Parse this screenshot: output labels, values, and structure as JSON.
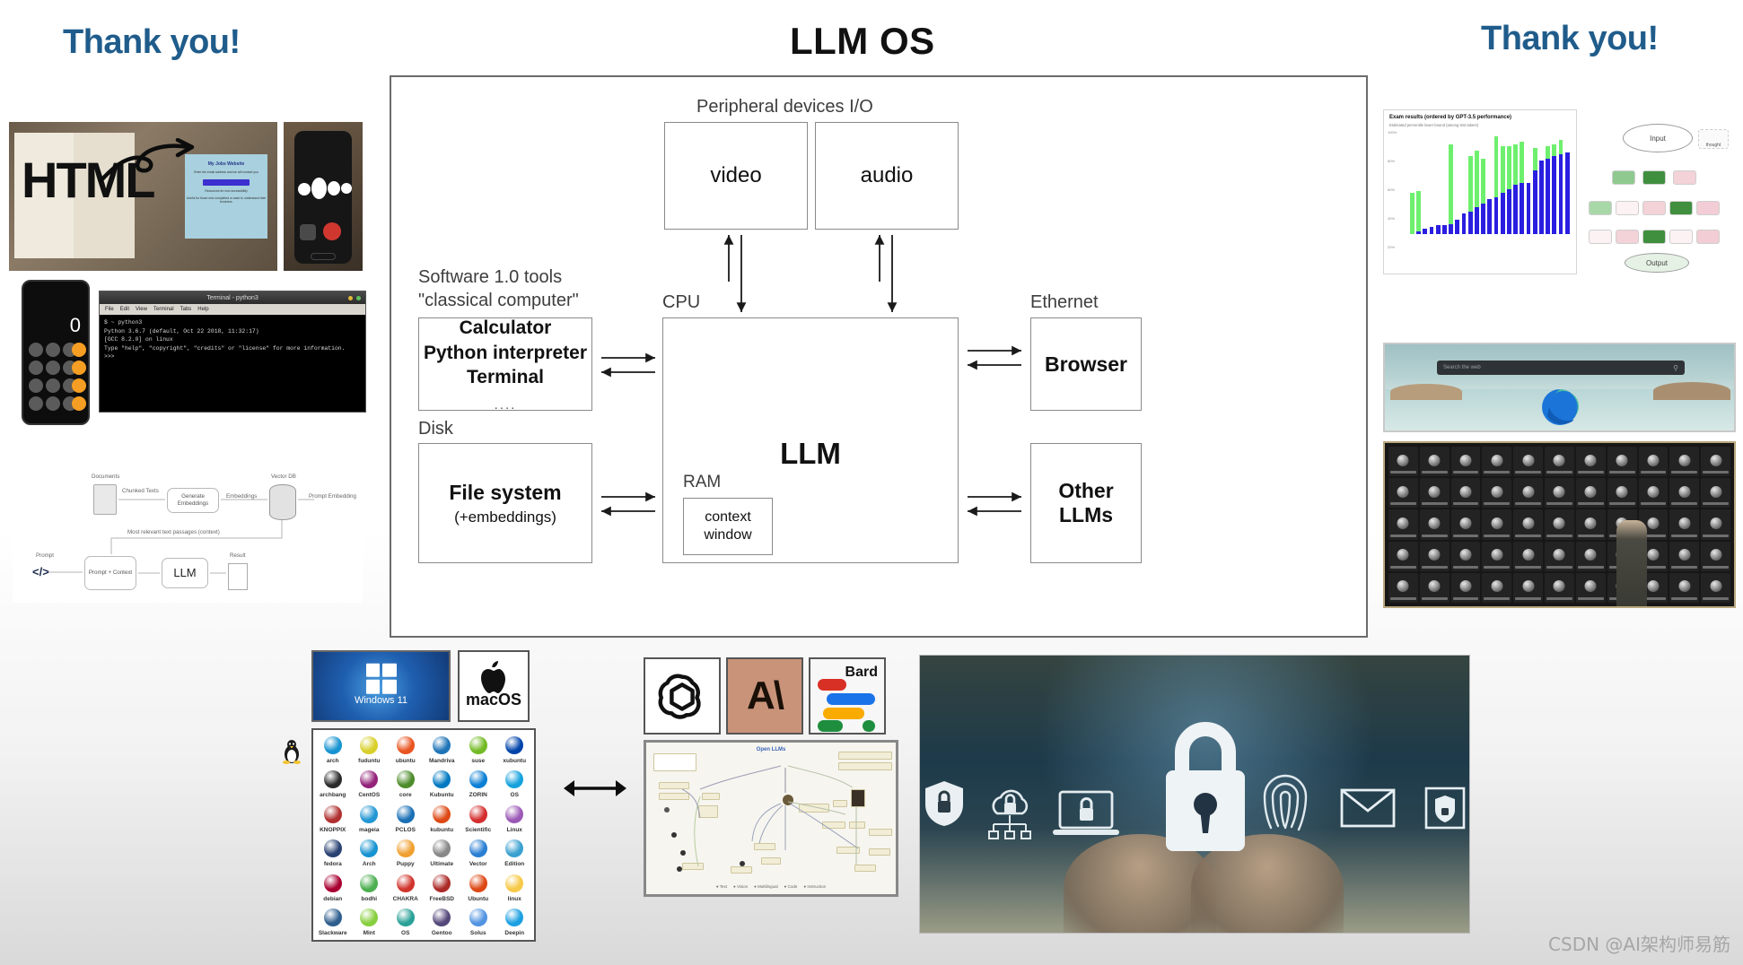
{
  "slide": {
    "title": "LLM OS",
    "thanks_left": "Thank you!",
    "thanks_right": "Thank you!",
    "watermark": "CSDN @AI架构师易筋",
    "accent_blue": "#1f5c8b",
    "frame_border": "#6b6b6b"
  },
  "diagram": {
    "peripheral_label": "Peripheral devices I/O",
    "video_label": "video",
    "audio_label": "audio",
    "software_label_line1": "Software 1.0 tools",
    "software_label_line2": "\"classical computer\"",
    "tools": {
      "line1": "Calculator",
      "line2": "Python interpreter",
      "line3": "Terminal",
      "line4": "...."
    },
    "disk_label": "Disk",
    "filesystem": {
      "line1": "File system",
      "line2": "(+embeddings)"
    },
    "cpu_label": "CPU",
    "llm_label": "LLM",
    "ram_label": "RAM",
    "context_window": {
      "line1": "context",
      "line2": "window"
    },
    "ethernet_label": "Ethernet",
    "browser_label": "Browser",
    "other_llms_label": "Other LLMs"
  },
  "left_media": {
    "html_note": {
      "name": "html-sketch-to-website-photo",
      "word": "HTML",
      "site_title": "My Jobs Website",
      "site_sub": "Enter the email address and we will contact you",
      "site_link": "Resources for new accessibility",
      "site_foot": "Useful for those who completed or want to understand their business"
    },
    "phone_call": {
      "name": "phone-voice-call-photo"
    },
    "calculator_phone": {
      "name": "phone-calculator-photo",
      "readout": "0"
    },
    "terminal": {
      "name": "linux-terminal-screenshot",
      "titlebar": "Terminal - python3",
      "menu": [
        "File",
        "Edit",
        "View",
        "Terminal",
        "Tabs",
        "Help"
      ],
      "body": "$ ~ python3\nPython 3.6.7 (default, Oct 22 2018, 11:32:17)\n[GCC 8.2.0] on linux\nType \"help\", \"copyright\", \"credits\" or \"license\" for more information.\n>>> "
    },
    "rag_diagram": {
      "name": "rag-pipeline-diagram",
      "labels": {
        "documents": "Documents",
        "chunked_texts": "Chunked Texts",
        "generate_embeddings": "Generate Embeddings",
        "embeddings": "Embeddings",
        "vector_db": "Vector DB",
        "prompt_embedding": "Prompt Embedding",
        "context_passages": "Most relevant text passages (context)",
        "prompt": "Prompt",
        "code_glyph": "</>",
        "prompt_context": "Prompt + Context",
        "llm": "LLM",
        "result": "Result"
      }
    }
  },
  "right_media": {
    "exam_chart": {
      "name": "gpt4-exam-results-chart",
      "title": "Exam results (ordered by GPT-3.5 performance)",
      "subtitle": "Estimated percentile lower bound (among test takers)"
    },
    "tree_of_thought": {
      "name": "tree-of-thought-diagram",
      "input": "Input",
      "output": "Output",
      "legend": "thought"
    },
    "edge_browser": {
      "name": "microsoft-edge-new-tab-screenshot",
      "search_placeholder": "Search the web"
    },
    "gpt_grid": {
      "name": "gpt-store-grid-slide"
    }
  },
  "bottom": {
    "windows": {
      "name": "windows-11-tile",
      "label": "Windows 11"
    },
    "macos": {
      "name": "macos-tile",
      "label": "macOS"
    },
    "linux": {
      "name": "linux-distros-collage",
      "distros": [
        {
          "label": "arch",
          "color": "#1793d1"
        },
        {
          "label": "fuduntu",
          "color": "#d8cf2a"
        },
        {
          "label": "ubuntu",
          "color": "#e95420"
        },
        {
          "label": "Mandriva",
          "color": "#1f74b8"
        },
        {
          "label": "suse",
          "color": "#73ba25"
        },
        {
          "label": "xubuntu",
          "color": "#0044aa"
        },
        {
          "label": "archbang",
          "color": "#2b2b2b"
        },
        {
          "label": "CentOS",
          "color": "#932279"
        },
        {
          "label": "core",
          "color": "#4c8c2b"
        },
        {
          "label": "Kubuntu",
          "color": "#0079c1"
        },
        {
          "label": "ZORIN",
          "color": "#0b7fd4"
        },
        {
          "label": "OS",
          "color": "#15a2dd"
        },
        {
          "label": "KNOPPIX",
          "color": "#b03030"
        },
        {
          "label": "mageia",
          "color": "#2397d4"
        },
        {
          "label": "PCLOS",
          "color": "#1a6fb5"
        },
        {
          "label": "kubuntu",
          "color": "#dd4814"
        },
        {
          "label": "Scientific",
          "color": "#d42e2e"
        },
        {
          "label": "Linux",
          "color": "#9b59b6"
        },
        {
          "label": "fedora",
          "color": "#294172"
        },
        {
          "label": "Arch",
          "color": "#1793d1"
        },
        {
          "label": "Puppy",
          "color": "#f0a030"
        },
        {
          "label": "Ultimate",
          "color": "#888888"
        },
        {
          "label": "Vector",
          "color": "#2a7fd4"
        },
        {
          "label": "Edition",
          "color": "#3aa0d0"
        },
        {
          "label": "debian",
          "color": "#a80030"
        },
        {
          "label": "bodhi",
          "color": "#4caf50"
        },
        {
          "label": "CHAKRA",
          "color": "#d0342c"
        },
        {
          "label": "FreeBSD",
          "color": "#ab2b28"
        },
        {
          "label": "Ubuntu",
          "color": "#dd4814"
        },
        {
          "label": "linux",
          "color": "#f7c948"
        },
        {
          "label": "Slackware",
          "color": "#2e5e8e"
        },
        {
          "label": "Mint",
          "color": "#87cf3e"
        },
        {
          "label": "OS",
          "color": "#2aa198"
        },
        {
          "label": "Gentoo",
          "color": "#54487a"
        },
        {
          "label": "Solus",
          "color": "#5294e2"
        },
        {
          "label": "Deepin",
          "color": "#1ba0e1"
        }
      ]
    },
    "ai_logos": {
      "openai": {
        "name": "openai-logo-tile"
      },
      "anthropic": {
        "name": "anthropic-logo-tile",
        "mark": "A\\"
      },
      "bard": {
        "name": "google-bard-logo-tile",
        "label": "Bard"
      }
    },
    "knowledge_graph": {
      "name": "llm-ecosystem-graph",
      "title": "Open LLMs"
    },
    "security_photo": {
      "name": "cybersecurity-lock-photo",
      "icons": [
        "shield-lock-icon",
        "cloud-lock-icon",
        "laptop-lock-icon",
        "padlock-icon",
        "fingerprint-icon",
        "envelope-icon",
        "shield-check-icon"
      ]
    },
    "exchange_arrow": {
      "name": "bidirectional-arrow"
    }
  }
}
